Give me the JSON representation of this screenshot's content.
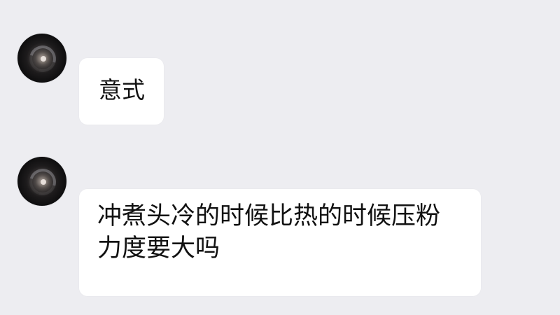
{
  "chat": {
    "messages": [
      {
        "sender": "",
        "text": "意式",
        "avatar_icon": "galaxy-avatar-icon"
      },
      {
        "sender": "",
        "text": "冲煮头冷的时候比热的时候压粉力度要大吗",
        "avatar_icon": "galaxy-avatar-icon"
      }
    ]
  },
  "colors": {
    "background": "#ededf1",
    "bubble": "#ffffff",
    "text": "#111111",
    "sender_blur": "#cfcfd5"
  }
}
